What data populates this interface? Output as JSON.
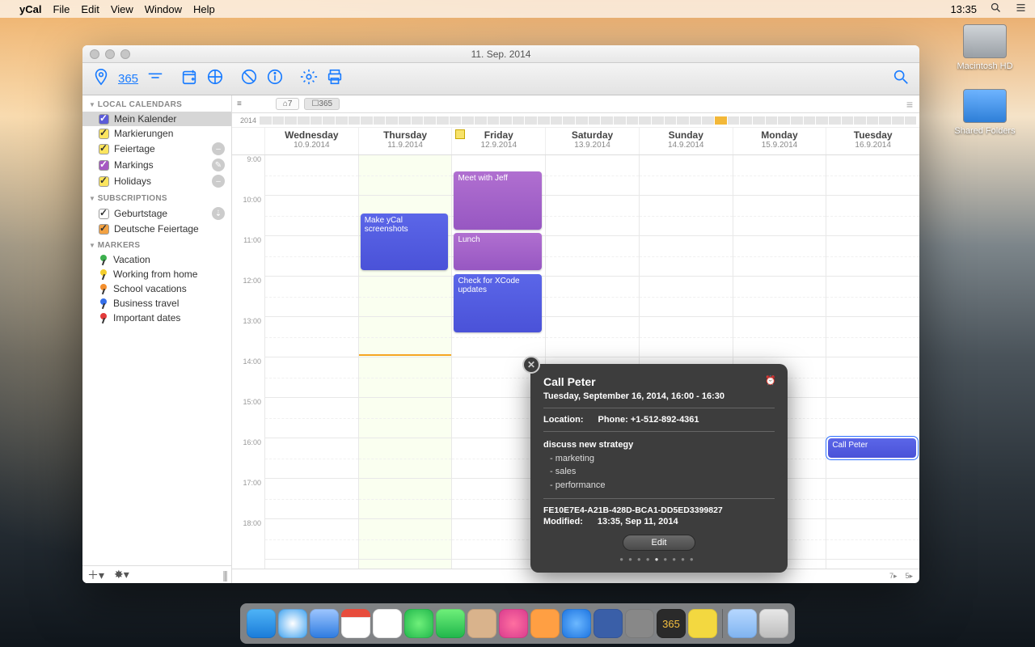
{
  "menubar": {
    "app": "yCal",
    "items": [
      "File",
      "Edit",
      "View",
      "Window",
      "Help"
    ],
    "clock": "13:35"
  },
  "desktop": {
    "hd": "Macintosh HD",
    "shared": "Shared Folders"
  },
  "window": {
    "title": "11. Sep. 2014",
    "toolbar": {
      "n365": "365"
    },
    "viewbar": {
      "week": "⌂7",
      "year": "☐365",
      "yearlabel": "2014"
    }
  },
  "sidebar": {
    "sec1": "LOCAL CALENDARS",
    "cal": [
      {
        "label": "Mein Kalender",
        "cls": "blue"
      },
      {
        "label": "Markierungen",
        "cls": "yel"
      },
      {
        "label": "Feiertage",
        "cls": "yel",
        "badge": "–"
      },
      {
        "label": "Markings",
        "cls": "pur",
        "badge": "✎"
      },
      {
        "label": "Holidays",
        "cls": "yel",
        "badge": "–"
      }
    ],
    "sec2": "SUBSCRIPTIONS",
    "sub": [
      {
        "label": "Geburtstage",
        "cls": "wht",
        "badge": "⇣"
      },
      {
        "label": "Deutsche Feiertage",
        "cls": "org"
      }
    ],
    "sec3": "MARKERS",
    "mk": [
      {
        "label": "Vacation",
        "c": "g"
      },
      {
        "label": "Working from home",
        "c": "y"
      },
      {
        "label": "School vacations",
        "c": "o"
      },
      {
        "label": "Business travel",
        "c": "b"
      },
      {
        "label": "Important dates",
        "c": "r"
      }
    ]
  },
  "days": [
    {
      "name": "Wednesday",
      "date": "10.9.2014"
    },
    {
      "name": "Thursday",
      "date": "11.9.2014",
      "today": true
    },
    {
      "name": "Friday",
      "date": "12.9.2014",
      "note": true
    },
    {
      "name": "Saturday",
      "date": "13.9.2014"
    },
    {
      "name": "Sunday",
      "date": "14.9.2014"
    },
    {
      "name": "Monday",
      "date": "15.9.2014"
    },
    {
      "name": "Tuesday",
      "date": "16.9.2014"
    }
  ],
  "hours": [
    "9:00",
    "10:00",
    "11:00",
    "12:00",
    "13:00",
    "14:00",
    "15:00",
    "16:00",
    "17:00",
    "18:00"
  ],
  "events": {
    "e1": "Make yCal screenshots",
    "e2": "Meet with Jeff",
    "e3": "Lunch",
    "e4": "Check for XCode updates",
    "e5": "Call Peter"
  },
  "popover": {
    "title": "Call Peter",
    "datetime": "Tuesday, September 16, 2014, 16:00 - 16:30",
    "loc_lbl": "Location:",
    "phone_lbl": "Phone: +1-512-892-4361",
    "notes_head": "discuss new strategy",
    "n1": "- marketing",
    "n2": "- sales",
    "n3": "- performance",
    "uid": "FE10E7E4-A21B-428D-BCA1-DD5ED3399827",
    "mod_lbl": "Modified:",
    "mod_val": "13:35, Sep 11, 2014",
    "edit": "Edit"
  },
  "gridfoot": {
    "l": "7▸",
    "r": "5▸"
  }
}
